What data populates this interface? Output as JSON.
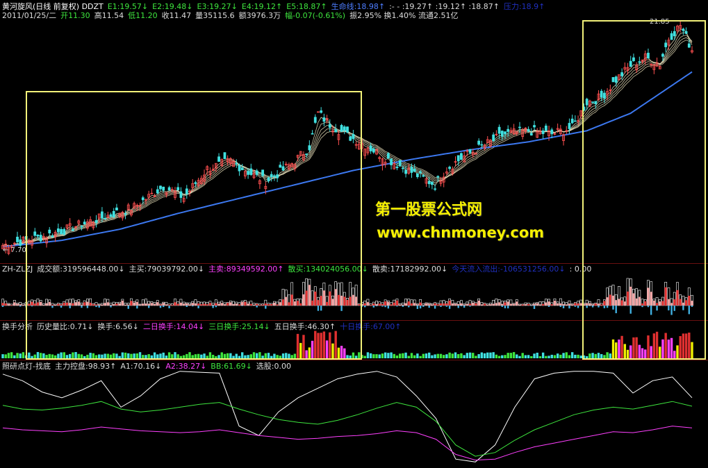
{
  "header": {
    "line1": [
      {
        "t": "黄河旋风(日线 前复权) DDZT",
        "c": "#ffffff"
      },
      {
        "t": "E1:19.57↓",
        "c": "#3ee63e"
      },
      {
        "t": "E2:19.48↓",
        "c": "#3ee63e"
      },
      {
        "t": "E3:19.27↓",
        "c": "#3ee63e"
      },
      {
        "t": "E4:19.12↑",
        "c": "#3ee63e"
      },
      {
        "t": "E5:18.87↑",
        "c": "#3ee63e"
      },
      {
        "t": "生命线:18.98↑",
        "c": "#4d7dff"
      },
      {
        "t": ":- - :19.27↑ :19.12↑ :18.87↑",
        "c": "#dddddd"
      },
      {
        "t": "压力:18.9↑",
        "c": "#2030c0"
      }
    ],
    "line2": [
      {
        "t": "2011/01/25/二",
        "c": "#dddddd"
      },
      {
        "t": "开11.30",
        "c": "#3ee63e"
      },
      {
        "t": "高11.54",
        "c": "#dddddd"
      },
      {
        "t": "低11.20",
        "c": "#3ee63e"
      },
      {
        "t": "收11.47",
        "c": "#dddddd"
      },
      {
        "t": "量35115.6",
        "c": "#dddddd"
      },
      {
        "t": "额3976.3万",
        "c": "#dddddd"
      },
      {
        "t": "幅-0.07(-0.61%)",
        "c": "#3ee63e"
      },
      {
        "t": "振2.95% 换1.40% 流通2.51亿",
        "c": "#dddddd"
      }
    ]
  },
  "price_panel": {
    "high_label": "21.85",
    "low_label": "← 7.70"
  },
  "watermark": {
    "line1": "第一股票公式网",
    "line2": "www.chnmoney.com"
  },
  "zlzj_header": [
    {
      "t": "ZH-ZLZJ",
      "c": "#dddddd"
    },
    {
      "t": "成交额:319596448.00↓",
      "c": "#dddddd"
    },
    {
      "t": "主买:79039792.00↓",
      "c": "#dddddd"
    },
    {
      "t": "主卖:89349592.00↑",
      "c": "#ff40ff"
    },
    {
      "t": "散买:134024056.00↓",
      "c": "#3ee63e"
    },
    {
      "t": "散卖:17182992.00↓",
      "c": "#dddddd"
    },
    {
      "t": "今天流入流出:-106531256.00↓",
      "c": "#2030c0"
    },
    {
      "t": ": 0.00",
      "c": "#dddddd"
    }
  ],
  "turnover_header": [
    {
      "t": "换手分析",
      "c": "#dddddd"
    },
    {
      "t": "历史量比:0.71↓",
      "c": "#dddddd"
    },
    {
      "t": "换手:6.56↓",
      "c": "#dddddd"
    },
    {
      "t": "二日换手:14.04↓",
      "c": "#ff40ff"
    },
    {
      "t": "三日换手:25.14↓",
      "c": "#3ee63e"
    },
    {
      "t": "五日换手:46.30↑",
      "c": "#dddddd"
    },
    {
      "t": "十日换手:67.00↑",
      "c": "#2030c0"
    }
  ],
  "osc_header": [
    {
      "t": "照研点灯-找底",
      "c": "#dddddd"
    },
    {
      "t": "主力控盘:98.93↑",
      "c": "#dddddd"
    },
    {
      "t": "A1:70.16↓",
      "c": "#dddddd"
    },
    {
      "t": "A2:38.27↓",
      "c": "#ff40ff"
    },
    {
      "t": "BB:61.69↓",
      "c": "#3ee63e"
    },
    {
      "t": "选股:0.00",
      "c": "#dddddd"
    }
  ],
  "colors": {
    "up": "#ff5050",
    "down": "#40e0e0",
    "life": "#3c78f0",
    "ma": "#f0e6c0",
    "hl_box": "#f3f27a",
    "sep": "#6a1010"
  },
  "chart_data": {
    "type": "line",
    "title": "黄河旋风(日线 前复权)",
    "price_ylim": [
      7.7,
      21.85
    ],
    "close_points": [
      [
        0,
        8.0
      ],
      [
        15,
        8.6
      ],
      [
        30,
        9.5
      ],
      [
        45,
        10.4
      ],
      [
        55,
        11.7
      ],
      [
        62,
        11.0
      ],
      [
        70,
        12.8
      ],
      [
        78,
        13.3
      ],
      [
        85,
        12.5
      ],
      [
        90,
        12.0
      ],
      [
        95,
        12.6
      ],
      [
        100,
        13.3
      ],
      [
        105,
        14.2
      ],
      [
        108,
        16.3
      ],
      [
        112,
        15.6
      ],
      [
        118,
        14.9
      ],
      [
        125,
        14.2
      ],
      [
        132,
        13.4
      ],
      [
        140,
        12.6
      ],
      [
        148,
        11.8
      ],
      [
        152,
        12.8
      ],
      [
        158,
        13.6
      ],
      [
        165,
        14.3
      ],
      [
        172,
        15.0
      ],
      [
        180,
        15.2
      ],
      [
        188,
        15.0
      ],
      [
        195,
        15.4
      ],
      [
        200,
        17.0
      ],
      [
        205,
        17.3
      ],
      [
        210,
        18.4
      ],
      [
        215,
        19.3
      ],
      [
        220,
        19.8
      ],
      [
        225,
        19.4
      ],
      [
        228,
        21.0
      ],
      [
        232,
        21.85
      ],
      [
        236,
        20.3
      ]
    ],
    "life_points": [
      [
        0,
        7.9
      ],
      [
        20,
        8.3
      ],
      [
        40,
        9.0
      ],
      [
        60,
        10.0
      ],
      [
        80,
        10.9
      ],
      [
        100,
        11.8
      ],
      [
        120,
        12.7
      ],
      [
        140,
        13.4
      ],
      [
        160,
        14.0
      ],
      [
        180,
        14.5
      ],
      [
        200,
        15.2
      ],
      [
        215,
        16.3
      ],
      [
        236,
        18.9
      ]
    ],
    "osc_series": [
      {
        "name": "A1",
        "values": [
          95,
          88,
          76,
          70,
          78,
          88,
          60,
          72,
          90,
          98,
          97,
          96,
          40,
          30,
          55,
          70,
          80,
          90,
          95,
          98,
          92,
          72,
          48,
          5,
          2,
          20,
          60,
          90,
          96,
          98,
          98,
          96,
          75,
          88,
          92,
          70
        ]
      },
      {
        "name": "BB",
        "values": [
          62,
          58,
          57,
          59,
          62,
          66,
          58,
          55,
          57,
          60,
          63,
          65,
          58,
          52,
          47,
          44,
          42,
          46,
          52,
          59,
          65,
          60,
          45,
          20,
          8,
          12,
          25,
          36,
          44,
          52,
          57,
          60,
          58,
          62,
          66,
          61
        ]
      },
      {
        "name": "A2",
        "values": [
          38,
          36,
          35,
          34,
          36,
          39,
          37,
          35,
          34,
          33,
          34,
          36,
          33,
          30,
          28,
          26,
          27,
          29,
          30,
          32,
          35,
          33,
          26,
          10,
          4,
          5,
          12,
          18,
          22,
          26,
          30,
          34,
          33,
          36,
          40,
          38
        ]
      }
    ]
  }
}
